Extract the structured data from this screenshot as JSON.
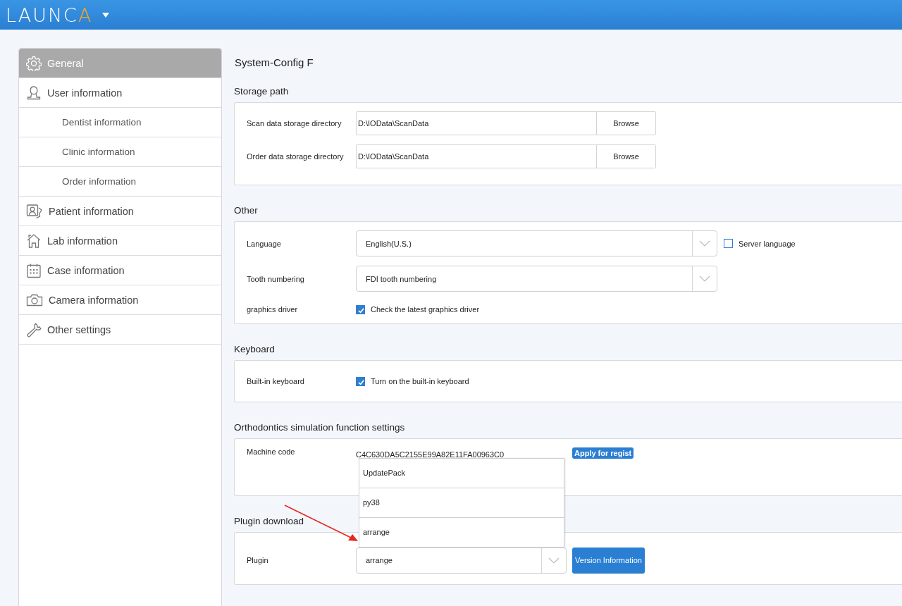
{
  "header": {
    "logo": {
      "main": "LAUNC",
      "accent": "A"
    }
  },
  "sidebar": {
    "items": [
      {
        "label": "General",
        "selected": true
      },
      {
        "label": "User information",
        "selected": false,
        "children": [
          {
            "label": "Dentist information",
            "selected": false
          },
          {
            "label": "Clinic information",
            "selected": false
          },
          {
            "label": "Order information",
            "selected": false
          }
        ]
      },
      {
        "label": "Patient information",
        "selected": false
      },
      {
        "label": "Lab information",
        "selected": false
      },
      {
        "label": "Case information",
        "selected": false
      },
      {
        "label": "Camera information",
        "selected": false
      },
      {
        "label": "Other settings",
        "selected": false
      }
    ]
  },
  "page_title": "System-Config F",
  "sections": [
    {
      "title": "Storage path",
      "rows": [
        {
          "kind": "path",
          "label": "Scan data storage directory",
          "value": "D:\\IOData\\ScanData",
          "button": "Browse"
        },
        {
          "kind": "path",
          "label": "Order data storage directory",
          "value": "D:\\IOData\\ScanData",
          "button": "Browse"
        }
      ]
    },
    {
      "title": "Other",
      "rows": [
        {
          "kind": "select",
          "label": "Language",
          "value": "English(U.S.)",
          "option": {
            "label": "Server language",
            "checked": false
          }
        },
        {
          "kind": "select",
          "label": "Tooth numbering",
          "value": "FDI tooth numbering"
        },
        {
          "kind": "checkbox",
          "label": "graphics driver",
          "option": {
            "label": "Check the latest graphics driver",
            "checked": true
          }
        }
      ]
    },
    {
      "title": "Keyboard",
      "rows": [
        {
          "kind": "checkbox",
          "label": "Built-in keyboard",
          "option": {
            "label": "Turn on the built-in keyboard",
            "checked": true
          }
        }
      ]
    },
    {
      "title": "Orthodontics simulation function settings",
      "rows": [
        {
          "kind": "code",
          "label": "Machine code",
          "value": "C4C630DA5C2155E99A82E11FA00963C0",
          "button": "Apply for regist"
        }
      ]
    },
    {
      "title": "Plugin download",
      "rows": [
        {
          "kind": "plugin",
          "label": "Plugin",
          "value": "arrange",
          "button": "Version Information",
          "expanded": true,
          "options": [
            "UpdatePack",
            "py38",
            "arrange"
          ]
        }
      ]
    }
  ]
}
